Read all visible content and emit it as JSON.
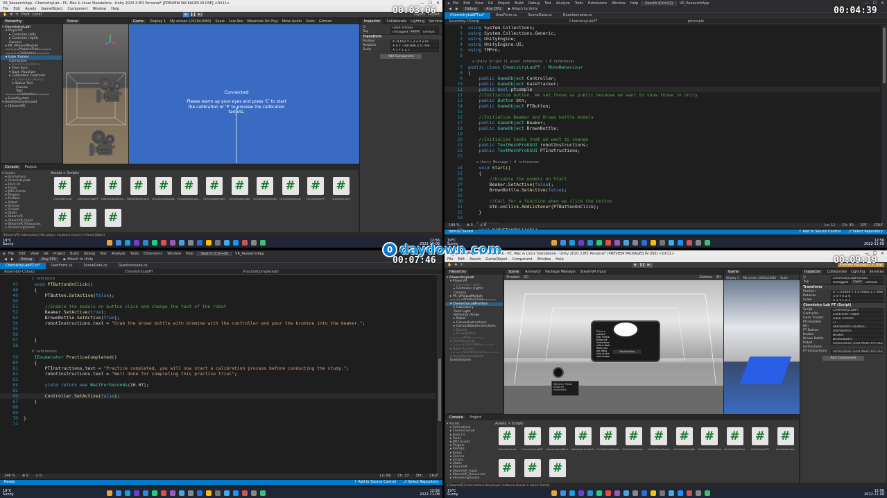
{
  "watermark": {
    "badge": "0",
    "text": "daydown.com"
  },
  "timestamps": {
    "tl": "00:03:06",
    "tr": "00:04:39",
    "bl": "00:07:46",
    "br": "00:09:19"
  },
  "taskbar": {
    "weather_temp": "19°C",
    "weather_desc": "Sunny",
    "tray_time": "12:56",
    "tray_date": "2022-11-08",
    "app_colors": [
      "#e8a33a",
      "#3c8ee6",
      "#1f9bd7",
      "#6a3fd1",
      "#2d8bd6",
      "#1dd17a",
      "#e74d3c",
      "#9b59b6",
      "#4aa3df",
      "#888888",
      "#2f6fd0",
      "#fbbd08",
      "#777777",
      "#3daee9",
      "#1e90ff",
      "#cc5555",
      "#888888",
      "#3fbf6f"
    ]
  },
  "unity_tl": {
    "title": "VR_ResearchApp - ChemistryLab - PC, Mac & Linux Standalone - Unity 2020.3.8f1 Personal* [PREVIEW PACKAGES IN USE] <DX11>",
    "menu": [
      "File",
      "Edit",
      "Assets",
      "GameObject",
      "Component",
      "Window",
      "Help"
    ],
    "toolbar_left": [
      "Pivot",
      "Local"
    ],
    "toolbar_right": [
      "Layers",
      "Layout"
    ],
    "hierarchy_title": "Hierarchy",
    "scene_tab": "Scene",
    "game_tab": "Game",
    "game_options": [
      "Display 1",
      "My screen (1920x1080)",
      "Scale",
      "Low Res",
      "Maximize On Play",
      "Mute Audio",
      "Stats",
      "Gizmos"
    ],
    "hierarchy": [
      {
        "label": "▾ ChemistryLab*",
        "indent": 0,
        "style": "hdr"
      },
      {
        "label": "▾ PlayerVR",
        "indent": 1,
        "style": ""
      },
      {
        "label": "▸ Controller (left)",
        "indent": 2,
        "style": ""
      },
      {
        "label": "▸ Controller (right)",
        "indent": 2,
        "style": ""
      },
      {
        "label": "Camera",
        "indent": 2,
        "style": ""
      },
      {
        "label": "▸ PR_VRInputModule",
        "indent": 1,
        "style": ""
      },
      {
        "label": "=====PracticeTrial=====",
        "indent": 1,
        "style": ""
      },
      {
        "label": "=====Calibration=====",
        "indent": 1,
        "style": ""
      },
      {
        "label": "▾ Gaze Tracker",
        "indent": 1,
        "style": "sel"
      },
      {
        "label": "Connection",
        "indent": 2,
        "style": ""
      },
      {
        "label": "▸ GazeTrackerMirror",
        "indent": 2,
        "style": "dim"
      },
      {
        "label": "▸ Time Sync",
        "indent": 2,
        "style": ""
      },
      {
        "label": "▾ Gaze Visualizer",
        "indent": 2,
        "style": ""
      },
      {
        "label": "▸ Calibration Controller",
        "indent": 2,
        "style": ""
      },
      {
        "label": "▸ Calibration Marker",
        "indent": 3,
        "style": "dim"
      },
      {
        "label": "▸ Status Text",
        "indent": 3,
        "style": ""
      },
      {
        "label": "Canvas",
        "indent": 4,
        "style": ""
      },
      {
        "label": "Text",
        "indent": 4,
        "style": ""
      },
      {
        "label": "=====Calibration=====",
        "indent": 1,
        "style": ""
      },
      {
        "label": "▸ EventSystem",
        "indent": 1,
        "style": ""
      },
      {
        "label": "▾ DontDestroyOnLoad",
        "indent": 0,
        "style": ""
      },
      {
        "label": "▸ [SteamVR]",
        "indent": 1,
        "style": ""
      }
    ],
    "game_text_title": "Connected",
    "game_text_body": "Please warm up your eyes and press 'C' to start the calibration or 'P' to preview the calibration targets.",
    "console_tabs": [
      "Console",
      "Project"
    ],
    "assets": [
      "▾ Assets",
      "▸ Animations",
      "▸ ChemistryLab",
      "▸ Dark UI",
      "▸ Fonts",
      "▸ JMO Assets",
      "▸ Plugins",
      "▸ Prefabs",
      "▸ Robot",
      "▸ Scenes",
      "▸ Scripts",
      "▸ Static",
      "▸ SteamVR",
      "▸ SteamVR_Input",
      "▸ SteamVR_Resources",
      "▸ StreamingAssets"
    ],
    "breadcrumb": "Assets > Scripts",
    "scripts": [
      "ChemistryLab",
      "ChemistryLabPT",
      "InteractableMani...",
      "MetaInteractionP...",
      "OnCollisionBubbl...",
      "OnCollisionExpl...",
      "OnCollisionFoam",
      "OnCollisionLight",
      "OnCollisionSmoke",
      "OnCollisionGlow",
      "OnCollisionPT",
      "Questionnaire"
    ],
    "inspector_tabs": [
      "Inspector",
      "Collaborate",
      "Lighting",
      "Services"
    ],
    "inspector_obj": "Gaze Tracker",
    "tag": "Untagged",
    "layer": "Default",
    "transform_title": "Transform",
    "transform": [
      {
        "k": "Position",
        "v": "X -0.652  Y 1.2  Z 0.279"
      },
      {
        "k": "Rotation",
        "v": "X 0  Y -180.886  Z 0.708"
      },
      {
        "k": "Scale",
        "v": "X 1  Y 1  Z 1"
      }
    ],
    "add_component": "Add Component",
    "status": "[SteamVR] Interaction] No player instance found in Hand.Start()"
  },
  "vs_tr": {
    "title": "VR_ResearchApp",
    "menu": [
      "File",
      "Edit",
      "View",
      "Git",
      "Project",
      "Build",
      "Debug",
      "Test",
      "Analyze",
      "Tools",
      "Extensions",
      "Window",
      "Help"
    ],
    "search": "Search (Ctrl+Q)",
    "toolbar": [
      "Debug",
      "Any CPU",
      "▶ Attach to Unity"
    ],
    "tabs": [
      "ChemistryLabPT.cs*",
      "UserForm.cs",
      "SceneData.cs",
      "Questionnaire.cs"
    ],
    "nav": [
      "Assembly-CSharp",
      "ChemistryLabPT",
      "ptcomple"
    ],
    "lines": [
      {
        "n": "1",
        "h": "<span class='kw'>using</span> System.Collections;"
      },
      {
        "n": "2",
        "h": "<span class='kw'>using</span> System.Collections.Generic;"
      },
      {
        "n": "3",
        "h": "<span class='kw'>using</span> UnityEngine;"
      },
      {
        "n": "4",
        "h": "<span class='kw'>using</span> UnityEngine.UI;"
      },
      {
        "n": "5",
        "h": "<span class='kw'>using</span> TMPro;"
      },
      {
        "n": "6",
        "h": ""
      },
      {
        "n": "",
        "h": "<span class='ref'>  ⊙ Unity Script (1 asset reference) | 0 references</span>"
      },
      {
        "n": "7",
        "h": "<span class='kw'>public class</span> <span class='ty'>ChemistryLabPT</span> : <span class='ty'>MonoBehaviour</span>"
      },
      {
        "n": "8",
        "h": "{"
      },
      {
        "n": "9",
        "h": "    <span class='kw'>public</span> <span class='ty'>GameObject</span> Controller;"
      },
      {
        "n": "10",
        "h": "    <span class='kw'>public</span> <span class='ty'>GameObject</span> GazeTracker;"
      },
      {
        "n": "11",
        "h": "    <span class='kw'>public bool</span> ptcomple",
        "cur": true
      },
      {
        "n": "12",
        "h": "    <span class='cm'>//Initialize button. We set those as public because we want to show those in Unity</span>"
      },
      {
        "n": "13",
        "h": "    <span class='kw'>public</span> <span class='ty'>Button</span> btn;"
      },
      {
        "n": "14",
        "h": "    <span class='kw'>public</span> <span class='ty'>GameObject</span> PTButton;"
      },
      {
        "n": "15",
        "h": ""
      },
      {
        "n": "16",
        "h": "    <span class='cm'>//Initialize Beaker and Brown bottle models</span>"
      },
      {
        "n": "17",
        "h": "    <span class='kw'>public</span> <span class='ty'>GameObject</span> Beaker;"
      },
      {
        "n": "18",
        "h": "    <span class='kw'>public</span> <span class='ty'>GameObject</span> BrownBottle;"
      },
      {
        "n": "19",
        "h": ""
      },
      {
        "n": "20",
        "h": "    <span class='cm'>//Initialize texts that we want to change</span>"
      },
      {
        "n": "21",
        "h": "    <span class='kw'>public</span> <span class='ty'>TextMeshProUGUI</span> robotInstructions;"
      },
      {
        "n": "22",
        "h": "    <span class='kw'>public</span> <span class='ty'>TextMeshProUGUI</span> PTInstructions;"
      },
      {
        "n": "23",
        "h": ""
      },
      {
        "n": "",
        "h": "<span class='ref'>    ⊙ Unity Message | 0 references</span>"
      },
      {
        "n": "24",
        "h": "    <span class='kw'>void</span> <span class='mt'>Start</span>()"
      },
      {
        "n": "25",
        "h": "    {"
      },
      {
        "n": "26",
        "h": "        <span class='cm'>//Disable the models on Start</span>"
      },
      {
        "n": "27",
        "h": "        Beaker.<span class='mt'>SetActive</span>(<span class='kw'>false</span>);"
      },
      {
        "n": "28",
        "h": "        BrownBottle.<span class='mt'>SetActive</span>(<span class='kw'>false</span>);"
      },
      {
        "n": "29",
        "h": ""
      },
      {
        "n": "30",
        "h": "        <span class='cm'>//Call for a function when we click the button</span>"
      },
      {
        "n": "31",
        "h": "        btn.onClick.<span class='mt'>AddListener</span>(PTButtonOnClick);"
      },
      {
        "n": "32",
        "h": "    }"
      },
      {
        "n": "33",
        "h": ""
      },
      {
        "n": "",
        "h": "<span class='ref'>    1 reference</span>"
      },
      {
        "n": "34",
        "h": "    <span class='kw'>void</span> <span class='mt'>PTButtonOnClick</span>()"
      }
    ],
    "errbar": [
      "146 %",
      "⊗ 3",
      "⚠ 0",
      "Ln: 11",
      "Ch: 30",
      "SPC",
      "CRLF"
    ],
    "status_left": "Item(s) Saved",
    "status_right": [
      "↑ Add to Source Control",
      "⎇ Select Repository"
    ]
  },
  "vs_bl": {
    "title": "VR_ResearchApp",
    "menu": [
      "File",
      "Edit",
      "View",
      "Git",
      "Project",
      "Build",
      "Debug",
      "Test",
      "Analyze",
      "Tools",
      "Extensions",
      "Window",
      "Help"
    ],
    "search": "Search (Ctrl+Q)",
    "toolbar": [
      "Debug",
      "Any CPU",
      "▶ Attach to Unity"
    ],
    "tabs": [
      "ChemistryLabPT.cs*",
      "UserForm.cs",
      "SceneData.cs",
      "Questionnaire.cs"
    ],
    "nav": [
      "Assembly-CSharp",
      "ChemistryLabPT",
      "PracticeCompleted()"
    ],
    "lines": [
      {
        "n": "",
        "h": "<span class='ref'>    1 reference</span>"
      },
      {
        "n": "47",
        "h": "    <span class='kw'>void</span> <span class='mt'>PTButtonOnClick</span>()"
      },
      {
        "n": "48",
        "h": "    {"
      },
      {
        "n": "49",
        "h": "        PTButton.<span class='mt'>SetActive</span>(<span class='kw'>false</span>);"
      },
      {
        "n": "50",
        "h": ""
      },
      {
        "n": "51",
        "h": "        <span class='cm'>//Enable the models on button click and change the text of the robot</span>"
      },
      {
        "n": "52",
        "h": "        Beaker.<span class='mt'>SetActive</span>(<span class='kw'>true</span>);"
      },
      {
        "n": "53",
        "h": "        BrownBottle.<span class='mt'>SetActive</span>(<span class='kw'>true</span>);"
      },
      {
        "n": "54",
        "h": "        robotInstructions.text = <span class='st'>\"Grab the brown bottle with bromine with the controller and pour the bromine into the beaker.\"</span>;"
      },
      {
        "n": "55",
        "h": ""
      },
      {
        "n": "56",
        "h": ""
      },
      {
        "n": "57",
        "h": "    }"
      },
      {
        "n": "58",
        "h": ""
      },
      {
        "n": "",
        "h": "<span class='ref'>    0 references</span>"
      },
      {
        "n": "59",
        "h": "    <span class='ty'>IEnumerator</span> <span class='mt'>PracticeCompleted</span>()"
      },
      {
        "n": "60",
        "h": "    {"
      },
      {
        "n": "61",
        "h": "        PTInstructions.text = <span class='st'>\"Practice completed, you will now start a calibration process before conducting the study.\"</span>;"
      },
      {
        "n": "62",
        "h": "        robotInstructions.text = <span class='st'>\"Well done for completing this practice trial\"</span>;"
      },
      {
        "n": "63",
        "h": ""
      },
      {
        "n": "64",
        "h": "        <span class='kw'>yield return new</span> <span class='ty'>WaitForSeconds</span>(10.0f);"
      },
      {
        "n": "65",
        "h": ""
      },
      {
        "n": "66",
        "h": "        Controller.<span class='mt'>SetActive</span>(<span class='kw'>false</span>);",
        "cur": true
      },
      {
        "n": "67",
        "h": "    }"
      },
      {
        "n": "68",
        "h": ""
      },
      {
        "n": "69",
        "h": ""
      },
      {
        "n": "70",
        "h": "}"
      },
      {
        "n": "71",
        "h": ""
      }
    ],
    "errbar": [
      "146 %",
      "⊗ 0",
      "⚠ 0",
      "Ln: 66",
      "Ch: 37",
      "SPC",
      "CRLF"
    ],
    "status_left": "Ready",
    "status_right": [
      "↑ Add to Source Control",
      "⎇ Select Repository"
    ]
  },
  "unity_br": {
    "title": "VR_ResearchApp - ChemistryLab - PC, Mac & Linux Standalone - Unity 2020.3.8f1 Personal* [PREVIEW PACKAGES IN USE] <DX11>",
    "menu": [
      "File",
      "Edit",
      "Assets",
      "GameObject",
      "Component",
      "Window",
      "Help"
    ],
    "scene_tabs": [
      "Scene",
      "Animator",
      "Package Manager",
      "SteamVR Input"
    ],
    "scene_opts": [
      "Shaded",
      "2D",
      "Gizmos",
      "All"
    ],
    "hierarchy": [
      {
        "label": "▾ ChemistryLab",
        "indent": 0,
        "style": "hdr"
      },
      {
        "label": "▾ PlayerVR",
        "indent": 1,
        "style": ""
      },
      {
        "label": "▸ Controller (left)",
        "indent": 2,
        "style": "dim"
      },
      {
        "label": "▸ Controller (right)",
        "indent": 2,
        "style": ""
      },
      {
        "label": "Camera",
        "indent": 2,
        "style": ""
      },
      {
        "label": "▸ PR_VRInputModule",
        "indent": 1,
        "style": ""
      },
      {
        "label": "=====PracticeTrial=====",
        "indent": 1,
        "style": ""
      },
      {
        "label": "▾ ChemistryLabPractice",
        "indent": 1,
        "style": "sel"
      },
      {
        "label": "▸ Laboratory",
        "indent": 2,
        "style": ""
      },
      {
        "label": "Point Light",
        "indent": 2,
        "style": ""
      },
      {
        "label": "Reflection Probe",
        "indent": 2,
        "style": ""
      },
      {
        "label": "▸ Robot",
        "indent": 2,
        "style": ""
      },
      {
        "label": "▸ CanvasInstructions",
        "indent": 2,
        "style": ""
      },
      {
        "label": "▸ CanvasRobotInstructions",
        "indent": 2,
        "style": ""
      },
      {
        "label": "▸ Beaker",
        "indent": 2,
        "style": "dim"
      },
      {
        "label": "▸ BrownBottle",
        "indent": 2,
        "style": "dim"
      },
      {
        "label": "=====Main=====",
        "indent": 1,
        "style": "dim"
      },
      {
        "label": "▸ ChemistryLab",
        "indent": 1,
        "style": "dim"
      },
      {
        "label": "=====Calibration=====",
        "indent": 1,
        "style": "dim"
      },
      {
        "label": "▸ Gaze Tracker",
        "indent": 1,
        "style": "dim"
      },
      {
        "label": "=====Questionnaire=====",
        "indent": 1,
        "style": "dim"
      },
      {
        "label": "▸ QuestionnaireBuild",
        "indent": 1,
        "style": "dim"
      },
      {
        "label": "EventSystem",
        "indent": 1,
        "style": ""
      }
    ],
    "panel_text": "This is a practice trial. Please follow the instructions of the robot. When you are ready click on the start button.",
    "panel_button": "Start Practice",
    "robot_text": "Welcome! Please follow my instructions.",
    "project_tabs": [
      "Console",
      "Project"
    ],
    "assets": [
      "▾ Assets",
      "▸ Animations",
      "▸ ChemistryLab",
      "▸ Dark UI",
      "▸ Fonts",
      "▸ JMO Assets",
      "▸ Plugins",
      "▸ Prefabs",
      "▸ Robot",
      "▸ Scenes",
      "▸ Scripts",
      "▸ Static",
      "▸ SteamVR",
      "▸ SteamVR_Input",
      "▸ SteamVR_Resources",
      "▸ StreamingAssets"
    ],
    "breadcrumb": "Assets > Scripts",
    "scripts": [
      "ChemistryLab",
      "ChemistryLabPT",
      "InteractableMani...",
      "MetaInteractionP...",
      "OnCollisionBubbl...",
      "OnCollisionExpl...",
      "OnCollisionFoam",
      "OnCollisionLight",
      "OnCollisionSmoke",
      "OnCollisionGlow",
      "OnCollisionPT",
      "Questionnaire"
    ],
    "game_tab": "Game",
    "game_opts": [
      "Display 1",
      "My screen (1920x1080)",
      "Scale"
    ],
    "inspector_tabs": [
      "Inspector",
      "Collaborate",
      "Lighting",
      "Services"
    ],
    "inspector_obj": "ChemistryLabPractice",
    "tag": "Untagged",
    "layer": "Default",
    "transform_title": "Transform",
    "transform": [
      {
        "k": "Position",
        "v": "X -1.03608  Y 1.079282  Z 1.666801"
      },
      {
        "k": "Rotation",
        "v": "X 0  Y 0  Z 0"
      },
      {
        "k": "Scale",
        "v": "X 1  Y 1  Z 1"
      }
    ],
    "script_title": "Chemistry Lab PT (Script)",
    "fields": [
      {
        "k": "Script",
        "v": "ChemistryLabPT"
      },
      {
        "k": "Controller",
        "v": "Controller (right)"
      },
      {
        "k": "Gaze Tracker",
        "v": "Gaze Tracker"
      },
      {
        "k": "Ptcomplete",
        "v": "☐"
      },
      {
        "k": "Btn",
        "v": "StartButton (Button)"
      },
      {
        "k": "PT Button",
        "v": "StartButton"
      },
      {
        "k": "Beaker",
        "v": "Beaker"
      },
      {
        "k": "Brown Bottle",
        "v": "BrownBottle"
      },
      {
        "k": "Robot Instructions",
        "v": "Instructions (Text Mesh Pro UGUI)"
      },
      {
        "k": "PT Instructions",
        "v": "Instructions (Text Mesh Pro UGUI)"
      }
    ],
    "add_component": "Add Component",
    "status": "[SteamVR] Interaction] No player instance found in Hand.Start()",
    "preview_badge": "Preview Packages in Use"
  }
}
